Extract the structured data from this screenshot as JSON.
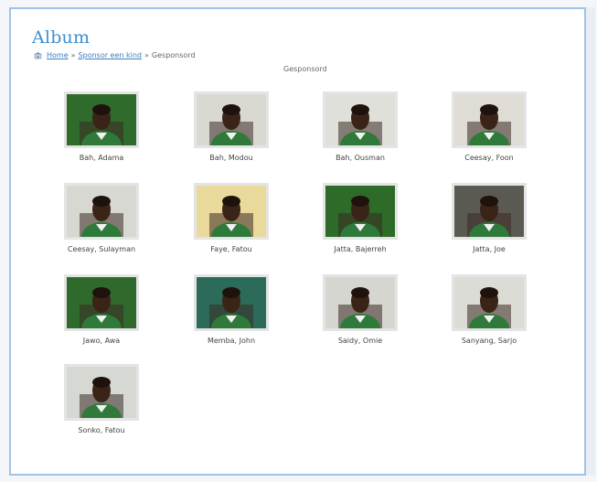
{
  "page": {
    "title": "Album",
    "album_label": "Gesponsord"
  },
  "breadcrumb": {
    "items": [
      "Home",
      "Sponsor een kind",
      "Gesponsord"
    ],
    "separator": "»"
  },
  "photos": [
    {
      "name": "Bah, Adama",
      "bg": "#2f6b2a"
    },
    {
      "name": "Bah, Modou",
      "bg": "#d9d9d2"
    },
    {
      "name": "Bah, Ousman",
      "bg": "#e0e0da"
    },
    {
      "name": "Ceesay, Foon",
      "bg": "#dedcd4"
    },
    {
      "name": "Ceesay, Sulayman",
      "bg": "#d8d8d2"
    },
    {
      "name": "Faye, Fatou",
      "bg": "#e9d99a"
    },
    {
      "name": "Jatta, Bajerreh",
      "bg": "#2e6a28"
    },
    {
      "name": "Jatta, Joe",
      "bg": "#5b5a52"
    },
    {
      "name": "Jawo, Awa",
      "bg": "#2f6a2c"
    },
    {
      "name": "Memba, John",
      "bg": "#2c6a5a"
    },
    {
      "name": "Saidy, Omie",
      "bg": "#d6d6d0"
    },
    {
      "name": "Sanyang, Sarjo",
      "bg": "#dcdcd6"
    },
    {
      "name": "Sonko, Fatou",
      "bg": "#d6d8d4"
    }
  ]
}
